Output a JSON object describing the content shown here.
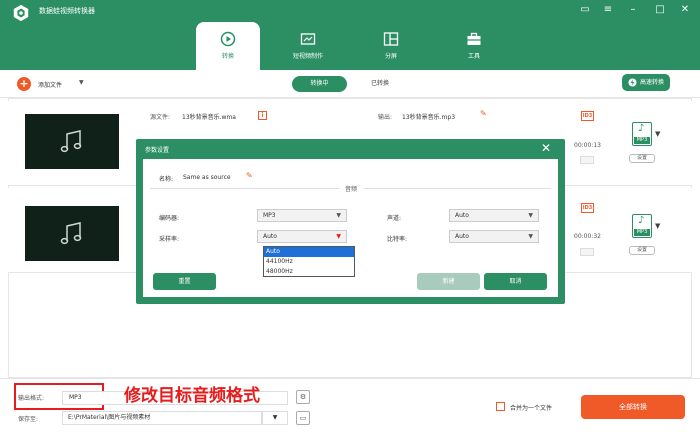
{
  "app": {
    "title": "数据蛙视频转换器"
  },
  "window_controls": [
    "chat-icon",
    "menu-icon",
    "minimize-icon",
    "maximize-icon",
    "close-icon"
  ],
  "nav": {
    "tabs": [
      {
        "label": "转换",
        "active": true
      },
      {
        "label": "短视频制作"
      },
      {
        "label": "分屏"
      },
      {
        "label": "工具"
      }
    ]
  },
  "toolbar": {
    "add_files": "添加文件",
    "converting": "转换中",
    "converted": "已转换",
    "fast_convert": "高速转换"
  },
  "files": [
    {
      "source_label": "源文件:",
      "source_name": "13秒背景音乐.wma",
      "output_label": "输出:",
      "output_name": "13秒背景音乐.mp3",
      "duration": "00:00:13",
      "format": "MP3",
      "settings": "设置",
      "id3": "ID3"
    },
    {
      "duration": "00:00:32",
      "format": "MP3",
      "settings": "设置",
      "id3": "ID3"
    }
  ],
  "dialog": {
    "title": "参数设置",
    "name_label": "名称:",
    "name_value": "Same as source",
    "section": "音频",
    "encoder_label": "编码器:",
    "encoder_value": "MP3",
    "channel_label": "声道:",
    "channel_value": "Auto",
    "samplerate_label": "采样率:",
    "samplerate_value": "Auto",
    "bitrate_label": "比特率:",
    "bitrate_value": "Auto",
    "samplerate_options": [
      "Auto",
      "44100Hz",
      "48000Hz"
    ],
    "reset": "重置",
    "create": "新建",
    "cancel": "取消"
  },
  "bottom": {
    "output_format_label": "输出格式:",
    "output_format_value": "MP3",
    "annotation": "修改目标音频格式",
    "save_to_label": "保存至:",
    "save_to_value": "E:\\PrMaterial\\图片与视频素材",
    "merge_label": "合并为一个文件",
    "convert_all": "全部转换"
  },
  "colors": {
    "brand": "#2b8f63",
    "accent": "#f05a28",
    "annotation": "#e81c1c",
    "highlight": "#1e6fd6"
  }
}
